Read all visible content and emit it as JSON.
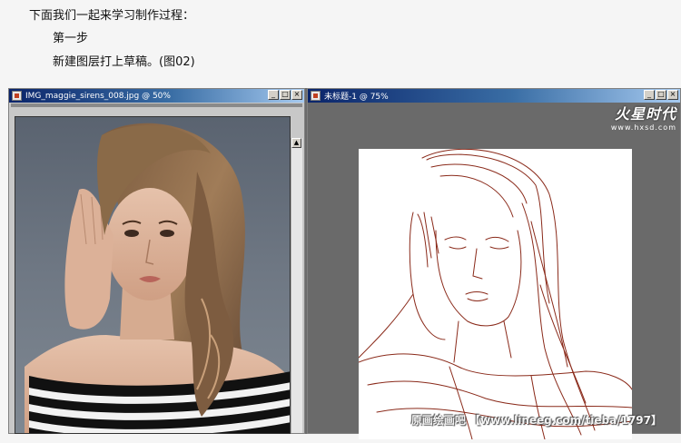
{
  "tutorial": {
    "line1": "下面我们一起来学习制作过程：",
    "line2": "第一步",
    "line3": "新建图层打上草稿。(图02)"
  },
  "windows": [
    {
      "title": "IMG_maggie_sirens_008.jpg @ 50%",
      "buttons": [
        "_",
        "□",
        "×"
      ]
    },
    {
      "title": "未标题-1 @ 75%",
      "buttons": [
        "_",
        "□",
        "×"
      ]
    }
  ],
  "logo": {
    "main": "火星时代",
    "sub": "www.hxsd.com"
  },
  "watermark": "原画绘画吧 【www.lineeg.com/tieba/1797】",
  "colors": {
    "sketch": "#8a2a1a",
    "titlebar": "#0a246a"
  }
}
